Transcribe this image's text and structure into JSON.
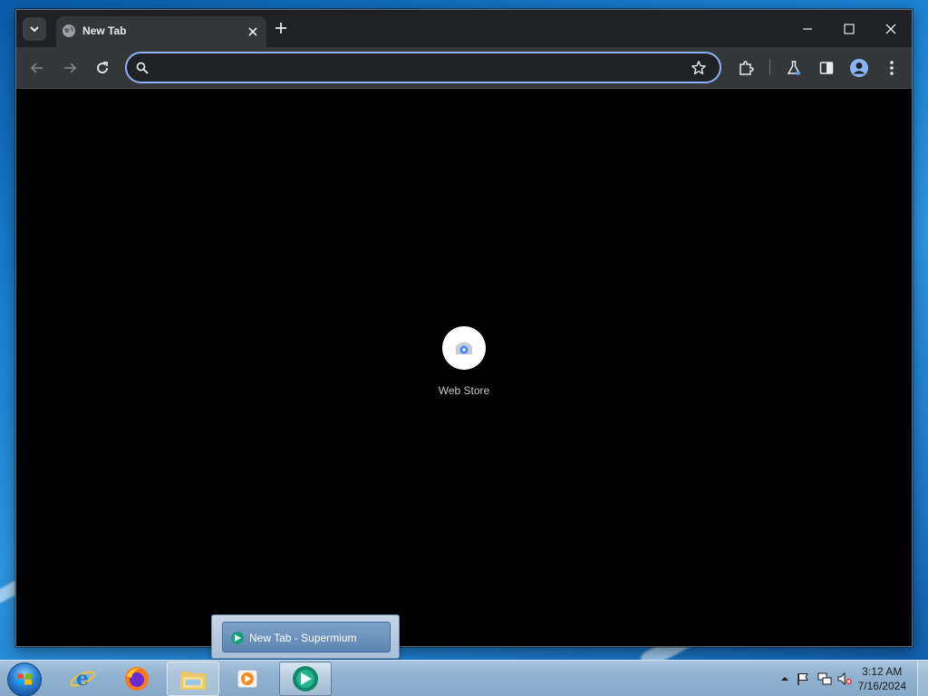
{
  "browser": {
    "tab_title": "New Tab",
    "omnibox": {
      "value": "",
      "placeholder": ""
    },
    "shortcuts": [
      {
        "label": "Web Store",
        "icon": "web-store-icon"
      }
    ],
    "colors": {
      "frame": "#202124",
      "toolbar": "#35363a",
      "omnibox_focus": "#8ab4f8",
      "content": "#000000"
    }
  },
  "toolbar_icons": [
    "back-arrow-icon",
    "forward-arrow-icon",
    "reload-icon",
    "search-icon",
    "bookmark-star-icon",
    "extensions-puzzle-icon",
    "labs-flask-icon",
    "side-panel-icon",
    "profile-avatar-icon",
    "more-menu-icon"
  ],
  "taskbar": {
    "apps": [
      {
        "name": "internet-explorer-icon"
      },
      {
        "name": "firefox-icon"
      },
      {
        "name": "file-explorer-icon"
      },
      {
        "name": "media-player-icon"
      },
      {
        "name": "supermium-icon"
      }
    ],
    "thumbnail": {
      "label": "New Tab - Supermium"
    },
    "clock": {
      "time": "3:12 AM",
      "date": "7/16/2024"
    }
  }
}
